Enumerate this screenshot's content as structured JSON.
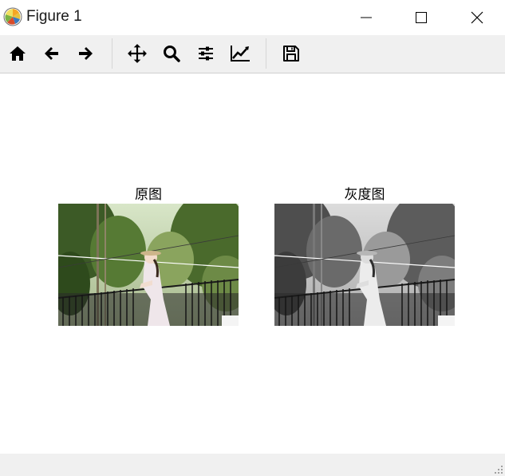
{
  "window": {
    "title": "Figure 1"
  },
  "toolbar": {
    "buttons": [
      {
        "name": "home-icon"
      },
      {
        "name": "back-icon"
      },
      {
        "name": "forward-icon"
      },
      {
        "name": "pan-icon"
      },
      {
        "name": "zoom-icon"
      },
      {
        "name": "configure-subplots-icon"
      },
      {
        "name": "edit-axis-icon"
      },
      {
        "name": "save-icon"
      }
    ]
  },
  "figure": {
    "subplots": [
      {
        "title": "原图",
        "mode": "color"
      },
      {
        "title": "灰度图",
        "mode": "grayscale"
      }
    ]
  },
  "colors": {
    "toolbar_bg": "#f0f0f0",
    "icon": "#000000"
  }
}
